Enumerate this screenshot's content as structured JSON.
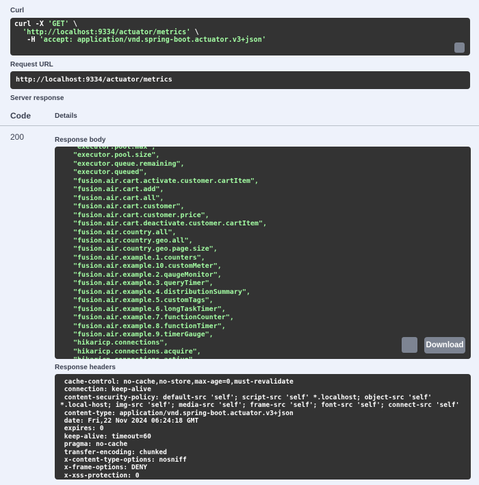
{
  "curl": {
    "label": "Curl",
    "line1_prefix": "curl -X ",
    "line1_method": "'GET'",
    "line1_suffix": " \\",
    "line2_url": "'http://localhost:9334/actuator/metrics'",
    "line2_suffix": " \\",
    "line3_prefix": "  -H ",
    "line3_header": "'accept: application/vnd.spring-boot.actuator.v3+json'"
  },
  "request_url": {
    "label": "Request URL",
    "value": "http://localhost:9334/actuator/metrics"
  },
  "server_response": {
    "label": "Server response",
    "col_code": "Code",
    "col_details": "Details",
    "code": "200"
  },
  "response_body": {
    "label": "Response body",
    "lines": [
      "\"executor.pool.max\",",
      "\"executor.pool.size\",",
      "\"executor.queue.remaining\",",
      "\"executor.queued\",",
      "\"fusion.air.cart.activate.customer.cartItem\",",
      "\"fusion.air.cart.add\",",
      "\"fusion.air.cart.all\",",
      "\"fusion.air.cart.customer\",",
      "\"fusion.air.cart.customer.price\",",
      "\"fusion.air.cart.deactivate.customer.cartItem\",",
      "\"fusion.air.country.all\",",
      "\"fusion.air.country.geo.all\",",
      "\"fusion.air.country.geo.page.size\",",
      "\"fusion.air.example.1.counters\",",
      "\"fusion.air.example.10.customMeter\",",
      "\"fusion.air.example.2.qaugeMonitor\",",
      "\"fusion.air.example.3.queryTimer\",",
      "\"fusion.air.example.4.distributionSummary\",",
      "\"fusion.air.example.5.customTags\",",
      "\"fusion.air.example.6.longTaskTimer\",",
      "\"fusion.air.example.7.functionCounter\",",
      "\"fusion.air.example.8.functionTimer\",",
      "\"fusion.air.example.9.timerGauge\",",
      "\"hikaricp.connections\",",
      "\"hikaricp.connections.acquire\",",
      "\"hikaricp.connections.active\","
    ],
    "download_label": "Download"
  },
  "response_headers": {
    "label": "Response headers",
    "lines": [
      " cache-control: no-cache,no-store,max-age=0,must-revalidate",
      " connection: keep-alive",
      " content-security-policy: default-src 'self'; script-src 'self' *.localhost; object-src 'self' *.local-host; img-src 'self'; media-src 'self'; frame-src 'self'; font-src 'self'; connect-src 'self'",
      " content-type: application/vnd.spring-boot.actuator.v3+json",
      " date: Fri,22 Nov 2024 06:24:18 GMT",
      " expires: 0",
      " keep-alive: timeout=60",
      " pragma: no-cache",
      " transfer-encoding: chunked",
      " x-content-type-options: nosniff",
      " x-frame-options: DENY",
      " x-xss-protection: 0"
    ]
  },
  "colors": {
    "background": "#eef2fb",
    "code_bg": "#333333",
    "string_green": "#a2fca2",
    "button_gray": "#7d8492"
  }
}
